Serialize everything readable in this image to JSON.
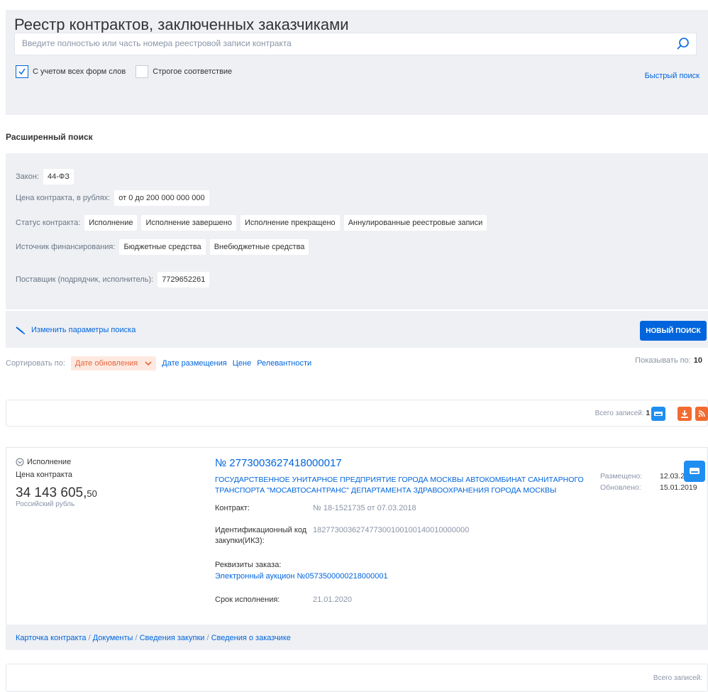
{
  "quick_search": {
    "title": "Реестр контрактов, заключенных заказчиками",
    "placeholder": "Введите полностью или часть номера реестровой записи контракта",
    "value": "",
    "checkbox_all_forms": "С учетом всех форм слов",
    "checkbox_all_forms_checked": true,
    "checkbox_strict": "Строгое соответствие",
    "checkbox_strict_checked": false,
    "quick_search_link": "Быстрый поиск"
  },
  "advanced": {
    "title": "Расширенный поиск",
    "law_label": "Закон:",
    "law_value": "44-ФЗ",
    "price_label": "Цена контракта, в рублях:",
    "price_value": "от 0 до 200 000 000 000",
    "status_label": "Статус контракта:",
    "statuses": [
      "Исполнение",
      "Исполнение завершено",
      "Исполнение прекращено",
      "Аннулированные реестровые записи"
    ],
    "funding_label": "Источник финансирования:",
    "funding": [
      "Бюджетные средства",
      "Внебюджетные средства"
    ],
    "supplier_label": "Поставщик (подрядчик, исполнитель):",
    "supplier_value": "7729652261",
    "change_params": "Изменить параметры поиска",
    "new_search": "НОВЫЙ ПОИСК"
  },
  "sort": {
    "label": "Сортировать по:",
    "active": "Дате обновления",
    "options": [
      "Дате размещения",
      "Цене",
      "Релевантности"
    ],
    "per_page_label": "Показывать по:",
    "per_page_value": "10"
  },
  "totals": {
    "label": "Всего записей:",
    "count": "1"
  },
  "contract": {
    "status": "Исполнение",
    "price_label": "Цена контракта",
    "price_int": "34 143 605,",
    "price_cents": "50",
    "currency": "Российский рубль",
    "reg_number": "№ 2773003627418000017",
    "customer": "ГОСУДАРСТВЕННОЕ УНИТАРНОЕ ПРЕДПРИЯТИЕ ГОРОДА МОСКВЫ АВТОКОМБИНАТ САНИТАРНОГО ТРАНСПОРТА \"МОСАВТОСАНТРАНС\" ДЕПАРТАМЕНТА ЗДРАВООХРАНЕНИЯ ГОРОДА МОСКВЫ",
    "contract_label": "Контракт:",
    "contract_value": "№ 18-1521735 от 07.03.2018",
    "ikz_label_1": "Идентификационный код",
    "ikz_label_2": "закупки(ИКЗ):",
    "ikz_value": "182773003627477300100100140010000000",
    "order_label": "Реквизиты заказа:",
    "order_value": "Электронный аукцион №0573500000218000001",
    "deadline_label": "Срок исполнения:",
    "deadline_value": "21.01.2020",
    "posted_label": "Размещено:",
    "posted_value": "12.03.2018",
    "updated_label": "Обновлено:",
    "updated_value": "15.01.2019",
    "footer_links": [
      "Карточка контракта",
      "Документы",
      "Сведения закупки",
      "Сведения о заказчике"
    ],
    "footer_sep": " / "
  },
  "colors": {
    "accent": "#0065dd",
    "sort_active": "#e8643a",
    "download": "#f26b2f",
    "rss": "#f26b2f",
    "print": "#1f8ef1"
  }
}
